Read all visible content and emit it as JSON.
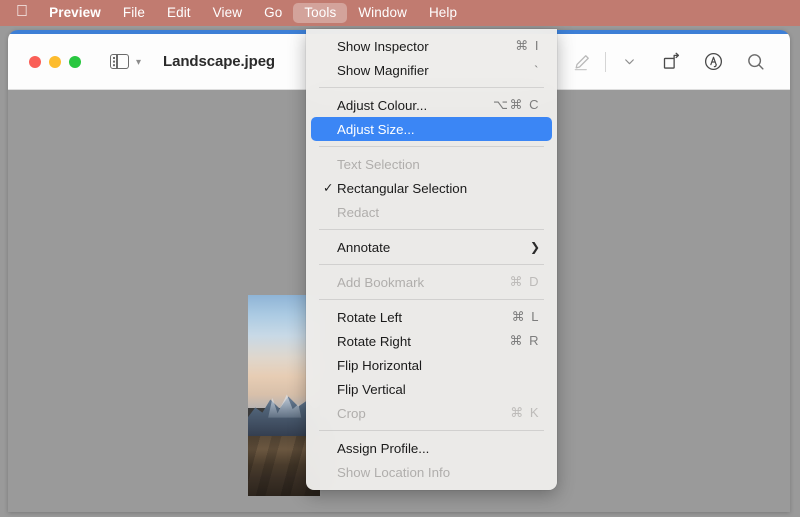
{
  "menubar": {
    "apple_icon": "apple-logo-icon",
    "apple_glyph": "",
    "items": [
      {
        "label": "Preview",
        "bold": true,
        "active": false
      },
      {
        "label": "File",
        "bold": false,
        "active": false
      },
      {
        "label": "Edit",
        "bold": false,
        "active": false
      },
      {
        "label": "View",
        "bold": false,
        "active": false
      },
      {
        "label": "Go",
        "bold": false,
        "active": false
      },
      {
        "label": "Tools",
        "bold": false,
        "active": true
      },
      {
        "label": "Window",
        "bold": false,
        "active": false
      },
      {
        "label": "Help",
        "bold": false,
        "active": false
      }
    ],
    "background_color": "#c17b70",
    "text_color": "#ffffff"
  },
  "window": {
    "title": "Landscape.jpeg",
    "accent_color": "#3d7fd6",
    "traffic_lights": [
      {
        "name": "close",
        "color": "#fa5f57"
      },
      {
        "name": "minimize",
        "color": "#fdbc2e"
      },
      {
        "name": "zoom",
        "color": "#29c740"
      }
    ],
    "sidebar_icon": "sidebar-toggle-icon",
    "sidebar_chevron": "∨",
    "toolbar_right": [
      {
        "name": "markup-pen-icon",
        "label": "Markup"
      },
      {
        "name": "chevron-down-icon",
        "label": "More"
      },
      {
        "name": "rotate-icon",
        "label": "Rotate"
      },
      {
        "name": "sign-icon",
        "label": "Sign"
      },
      {
        "name": "search-icon",
        "label": "Search"
      }
    ],
    "document_name": "Landscape.jpeg"
  },
  "menu": {
    "title": "Tools",
    "highlight_color": "#3b86f5",
    "sections": [
      {
        "items": [
          {
            "label": "Show Inspector",
            "shortcut": "⌘ I",
            "disabled": false,
            "checked": false,
            "selected": false,
            "submenu": false
          },
          {
            "label": "Show Magnifier",
            "shortcut": "`",
            "disabled": false,
            "checked": false,
            "selected": false,
            "submenu": false
          }
        ]
      },
      {
        "items": [
          {
            "label": "Adjust Colour...",
            "shortcut": "⌥⌘ C",
            "disabled": false,
            "checked": false,
            "selected": false,
            "submenu": false
          },
          {
            "label": "Adjust Size...",
            "shortcut": "",
            "disabled": false,
            "checked": false,
            "selected": true,
            "submenu": false
          }
        ]
      },
      {
        "items": [
          {
            "label": "Text Selection",
            "shortcut": "",
            "disabled": true,
            "checked": false,
            "selected": false,
            "submenu": false
          },
          {
            "label": "Rectangular Selection",
            "shortcut": "",
            "disabled": false,
            "checked": true,
            "selected": false,
            "submenu": false
          },
          {
            "label": "Redact",
            "shortcut": "",
            "disabled": true,
            "checked": false,
            "selected": false,
            "submenu": false
          }
        ]
      },
      {
        "items": [
          {
            "label": "Annotate",
            "shortcut": "",
            "disabled": false,
            "checked": false,
            "selected": false,
            "submenu": true
          }
        ]
      },
      {
        "items": [
          {
            "label": "Add Bookmark",
            "shortcut": "⌘ D",
            "disabled": true,
            "checked": false,
            "selected": false,
            "submenu": false
          }
        ]
      },
      {
        "items": [
          {
            "label": "Rotate Left",
            "shortcut": "⌘ L",
            "disabled": false,
            "checked": false,
            "selected": false,
            "submenu": false
          },
          {
            "label": "Rotate Right",
            "shortcut": "⌘ R",
            "disabled": false,
            "checked": false,
            "selected": false,
            "submenu": false
          },
          {
            "label": "Flip Horizontal",
            "shortcut": "",
            "disabled": false,
            "checked": false,
            "selected": false,
            "submenu": false
          },
          {
            "label": "Flip Vertical",
            "shortcut": "",
            "disabled": false,
            "checked": false,
            "selected": false,
            "submenu": false
          },
          {
            "label": "Crop",
            "shortcut": "⌘ K",
            "disabled": true,
            "checked": false,
            "selected": false,
            "submenu": false
          }
        ]
      },
      {
        "items": [
          {
            "label": "Assign Profile...",
            "shortcut": "",
            "disabled": false,
            "checked": false,
            "selected": false,
            "submenu": false
          },
          {
            "label": "Show Location Info",
            "shortcut": "",
            "disabled": true,
            "checked": false,
            "selected": false,
            "submenu": false
          }
        ]
      }
    ],
    "check_glyph": "✓",
    "submenu_glyph": "❯"
  },
  "desktop": {
    "background_color": "#9a9a9a"
  },
  "photo": {
    "name": "landscape-photo",
    "description": "Mountain landscape at dusk"
  }
}
